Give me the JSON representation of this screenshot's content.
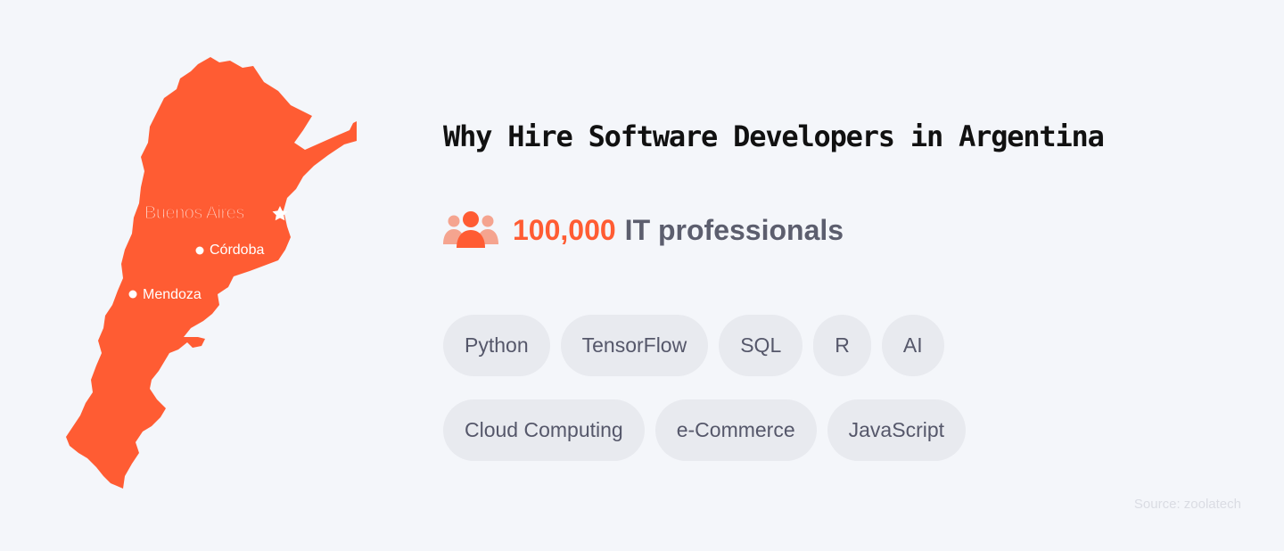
{
  "map": {
    "fill_color": "#ff5c33",
    "capital": "Buenos Aires",
    "cities": [
      "Córdoba",
      "Mendoza"
    ]
  },
  "title": "Why Hire Software Developers in Argentina",
  "stat": {
    "icon": "people-group-icon",
    "number": "100,000",
    "label": "IT professionals",
    "number_color": "#ff5c33"
  },
  "tags": [
    "Python",
    "TensorFlow",
    "SQL",
    "R",
    "AI",
    "Cloud Computing",
    "e-Commerce",
    "JavaScript"
  ],
  "source": "Source: zoolatech"
}
